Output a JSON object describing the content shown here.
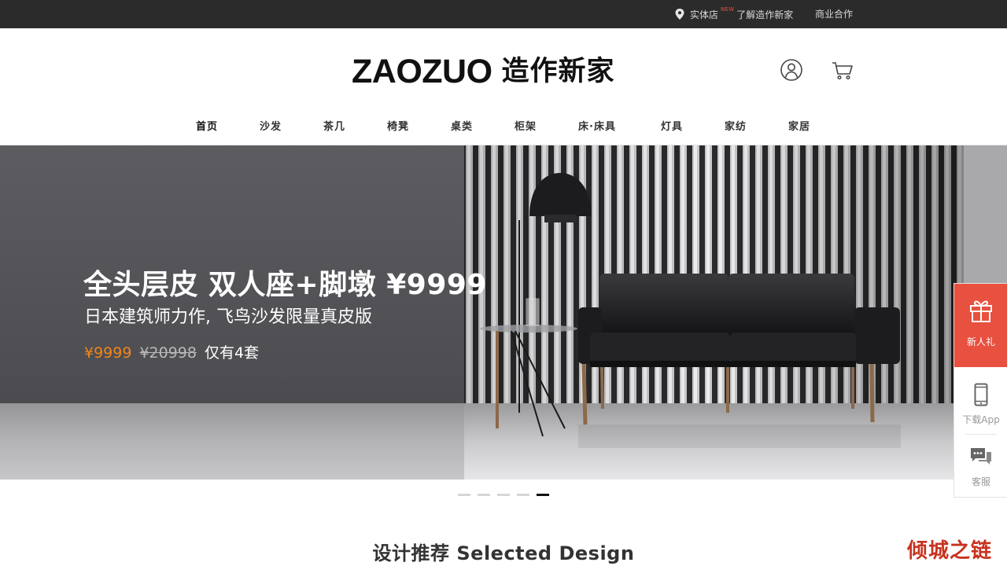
{
  "topbar": {
    "store_label": "实体店",
    "new_badge": "NEW",
    "learn_label": "了解造作新家",
    "business_label": "商业合作"
  },
  "header": {
    "logo_en": "ZAOZUO",
    "logo_zh": "造作新家"
  },
  "nav": {
    "items": [
      "首页",
      "沙发",
      "茶几",
      "椅凳",
      "桌类",
      "柜架",
      "床·床具",
      "灯具",
      "家纺",
      "家居"
    ],
    "active_index": 0
  },
  "hero": {
    "title": "全头层皮 双人座+脚墩 ¥9999",
    "subtitle": "日本建筑师力作, 飞鸟沙发限量真皮版",
    "price_now": "¥9999",
    "price_old": "¥20998",
    "stock_note": "仅有4套"
  },
  "carousel": {
    "count": 5,
    "active_index": 4
  },
  "section": {
    "title": "设计推荐 Selected Design"
  },
  "sidebar": {
    "gift_label": "新人礼",
    "app_label": "下载App",
    "service_label": "客服"
  },
  "watermark": {
    "text": "倾城之链"
  },
  "colors": {
    "topbar_bg": "#2b2b2b",
    "accent_price": "#f1861c",
    "gift_bg": "#e8503f",
    "new_badge": "#e0533d"
  }
}
